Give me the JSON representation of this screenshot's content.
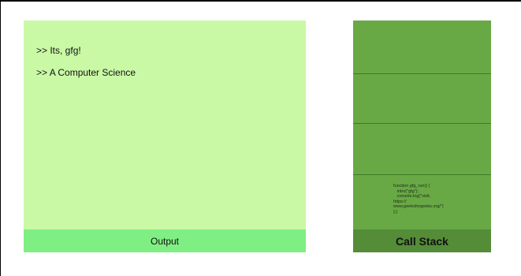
{
  "output": {
    "lines": [
      ">> Its, gfg!",
      ">> A Computer Science"
    ],
    "footer_label": "Output"
  },
  "call_stack": {
    "frame_code": "function gfg_run() {\n   intro(\"gfg\");\n   console.log(\"visit,\nhttps://\nwww.geeksforgeeks.org/\")\n};}",
    "footer_label": "Call Stack"
  },
  "colors": {
    "output_bg": "#caf9a6",
    "output_footer_bg": "#7fef83",
    "stack_bg": "#68a945",
    "stack_footer_bg": "#548c38"
  }
}
